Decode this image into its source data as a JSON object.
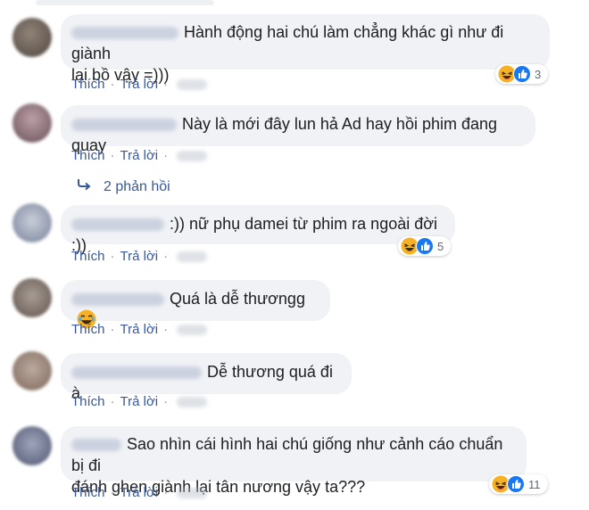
{
  "colors": {
    "bubble": "#f0f2f5",
    "link": "#385898",
    "meta": "#606770",
    "like_blue": "#1877f2",
    "haha_yellow": "#f7b125"
  },
  "actions": {
    "like_label": "Thích",
    "reply_label": "Trả lời",
    "separator": "·"
  },
  "replies_link": {
    "label": "2 phản hồi",
    "icon": "reply-arrow-icon"
  },
  "comments": [
    {
      "text": "Hành động hai chú làm chẳng khác gì như đi giành\nlại bồ vậy =)))",
      "reactions": [
        "haha-icon",
        "like-icon"
      ],
      "reaction_count": "3"
    },
    {
      "text": "Này là mới đây lun hả Ad hay hồi phim đang quay",
      "reactions": [],
      "reaction_count": ""
    },
    {
      "text": ":)) nữ phụ damei từ phim ra ngoài đời :))",
      "reactions": [
        "haha-icon",
        "like-icon"
      ],
      "reaction_count": "5"
    },
    {
      "text": "Quá là dễ thươngg",
      "inline_emoji": "laughing-emoji-icon",
      "reactions": [],
      "reaction_count": ""
    },
    {
      "text": "Dễ thương quá đi à",
      "reactions": [],
      "reaction_count": ""
    },
    {
      "text": "Sao nhìn cái hình hai chú giống như cảnh cáo chuẩn bị đi\nđánh ghen giành lại tân nương vậy ta???",
      "reactions": [
        "haha-icon",
        "like-icon"
      ],
      "reaction_count": "11"
    }
  ]
}
